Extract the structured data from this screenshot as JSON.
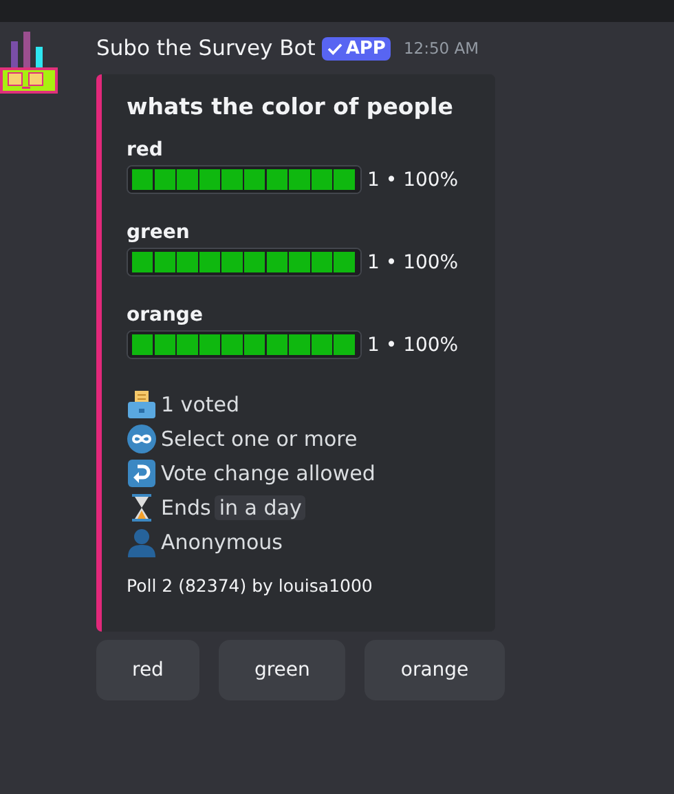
{
  "message": {
    "author": "Subo the Survey Bot",
    "badge": "APP",
    "time": "12:50 AM"
  },
  "poll": {
    "question": "whats the color of people",
    "options": [
      {
        "label": "red",
        "level": 1,
        "reading": "1 • 100%"
      },
      {
        "label": "green",
        "level": 1,
        "reading": "1 • 100%"
      },
      {
        "label": "orange",
        "level": 1,
        "reading": "1 • 100%"
      }
    ],
    "info": [
      {
        "kind": "votes",
        "text": "1 voted"
      },
      {
        "kind": "multi",
        "text": "Select one or more"
      },
      {
        "kind": "change",
        "text": "Vote change allowed"
      },
      {
        "kind": "ends",
        "text": "Ends",
        "value": "in a day"
      },
      {
        "kind": "anonymous",
        "text": "Anonymous"
      }
    ],
    "footer": "Poll  2 (82374) by louisa1000"
  },
  "buttons": [
    "red",
    "green",
    "orange"
  ]
}
